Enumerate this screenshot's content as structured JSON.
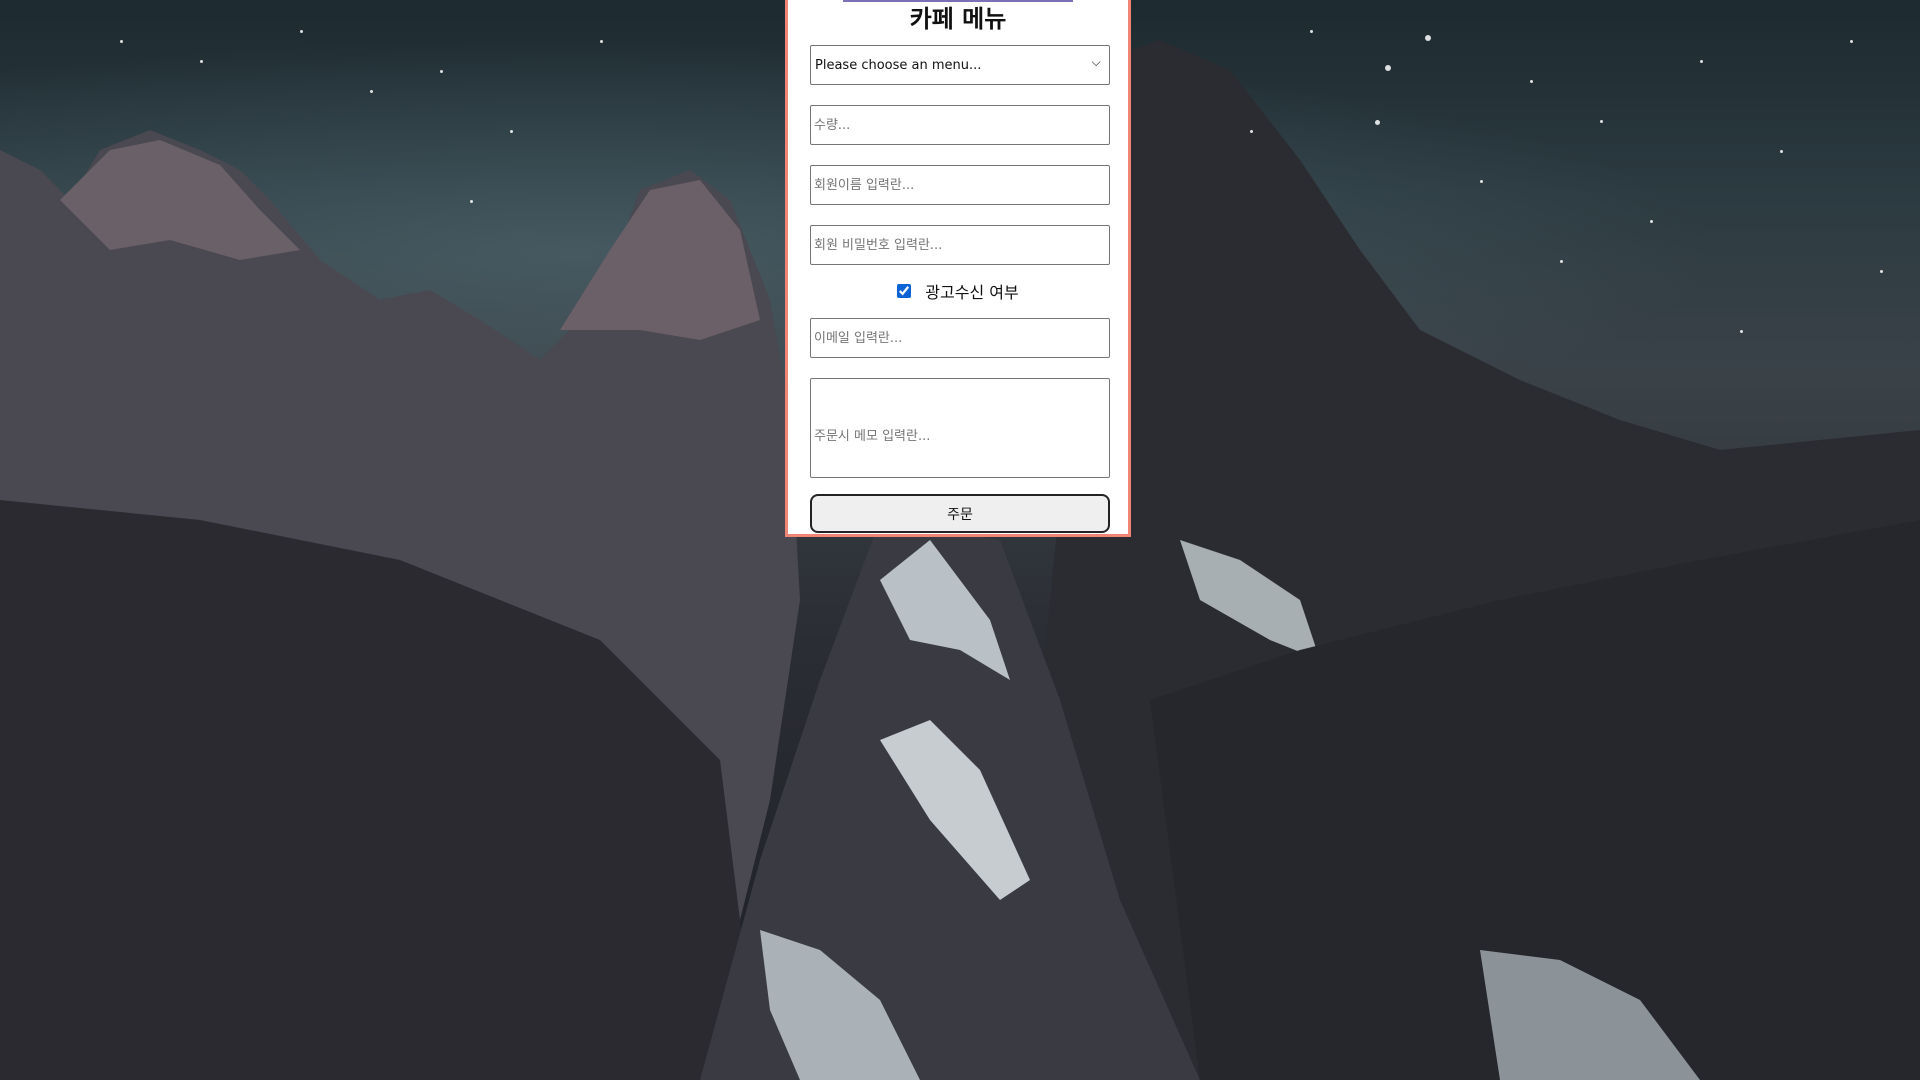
{
  "page": {
    "title": "카페 메뉴"
  },
  "form": {
    "menu_select": {
      "selected": "Please choose an menu...",
      "options": [
        "Please choose an menu..."
      ]
    },
    "quantity": {
      "placeholder": "수량..."
    },
    "member_name": {
      "placeholder": "회원이름 입력란..."
    },
    "member_password": {
      "placeholder": "회원 비밀번호 입력란..."
    },
    "ad_consent": {
      "label": "광고수신 여부",
      "checked": true
    },
    "email": {
      "placeholder": "이메일 입력란..."
    },
    "memo": {
      "placeholder": "주문시 메모 입력란..."
    },
    "submit_label": "주문"
  },
  "colors": {
    "panel_border": "#f08575",
    "checkbox_accent": "#0b63d6"
  },
  "icons": {
    "select_arrow": "chevron-down-icon"
  }
}
